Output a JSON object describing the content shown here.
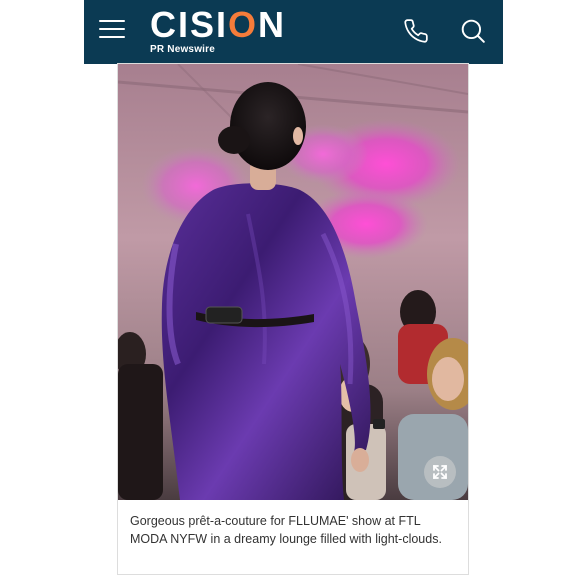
{
  "header": {
    "brand_name": "CISION",
    "brand_tagline": "PR Newswire",
    "menu_icon": "hamburger-menu-icon",
    "phone_icon": "phone-icon",
    "search_icon": "search-icon",
    "background_color": "#0b3a53",
    "accent_color": "#f57c3a"
  },
  "article": {
    "image_icon": "expand-icon",
    "caption": "Gorgeous prêt-a-couture for FLLUMAE' show at FTL MODA NYFW in a dreamy lounge filled with light-clouds."
  }
}
